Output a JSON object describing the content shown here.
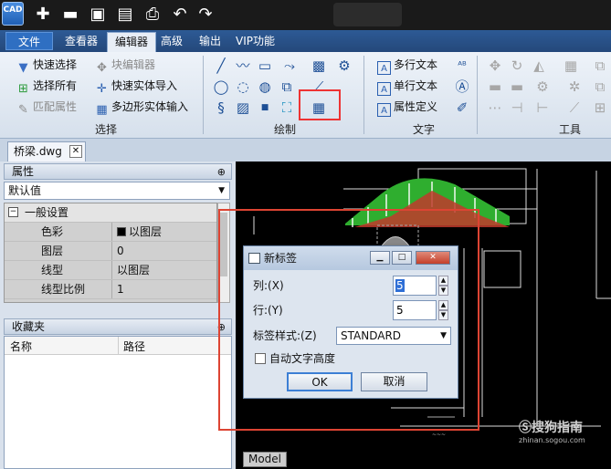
{
  "app": {
    "logo_text": "CAD"
  },
  "menu": [
    "文件",
    "查看器",
    "编辑器",
    "高级",
    "输出",
    "VIP功能"
  ],
  "ribbon": {
    "select": {
      "items": [
        "快速选择",
        "选择所有",
        "匹配属性"
      ],
      "label": "选择"
    },
    "block": {
      "items": [
        "块编辑器",
        "快速实体导入",
        "多边形实体输入"
      ]
    },
    "draw": {
      "label": "绘制"
    },
    "text": {
      "items": [
        "多行文本",
        "单行文本",
        "属性定义"
      ],
      "label": "文字"
    },
    "tools": {
      "label": "工具"
    }
  },
  "document": {
    "tab": "桥梁.dwg",
    "close": "✕"
  },
  "properties": {
    "title": "属性",
    "pin": "⊕",
    "selected": "默认值",
    "section": "一般设置",
    "rows": [
      {
        "key": "色彩",
        "value": "以图层"
      },
      {
        "key": "图层",
        "value": "0"
      },
      {
        "key": "线型",
        "value": "以图层"
      },
      {
        "key": "线型比例",
        "value": "1"
      }
    ]
  },
  "favorites": {
    "title": "收藏夹",
    "columns": [
      "名称",
      "路径"
    ]
  },
  "canvas": {
    "model_tab": "Model",
    "watermark": "搜狗指南",
    "watermark_url": "zhinan.sogou.com"
  },
  "dialog": {
    "title": "新标签",
    "col_label": "列:(X)",
    "col_value": "5",
    "row_label": "行:(Y)",
    "row_value": "5",
    "style_label": "标签样式:(Z)",
    "style_value": "STANDARD",
    "auto_height_label": "自动文字高度",
    "ok": "OK",
    "cancel": "取消"
  }
}
